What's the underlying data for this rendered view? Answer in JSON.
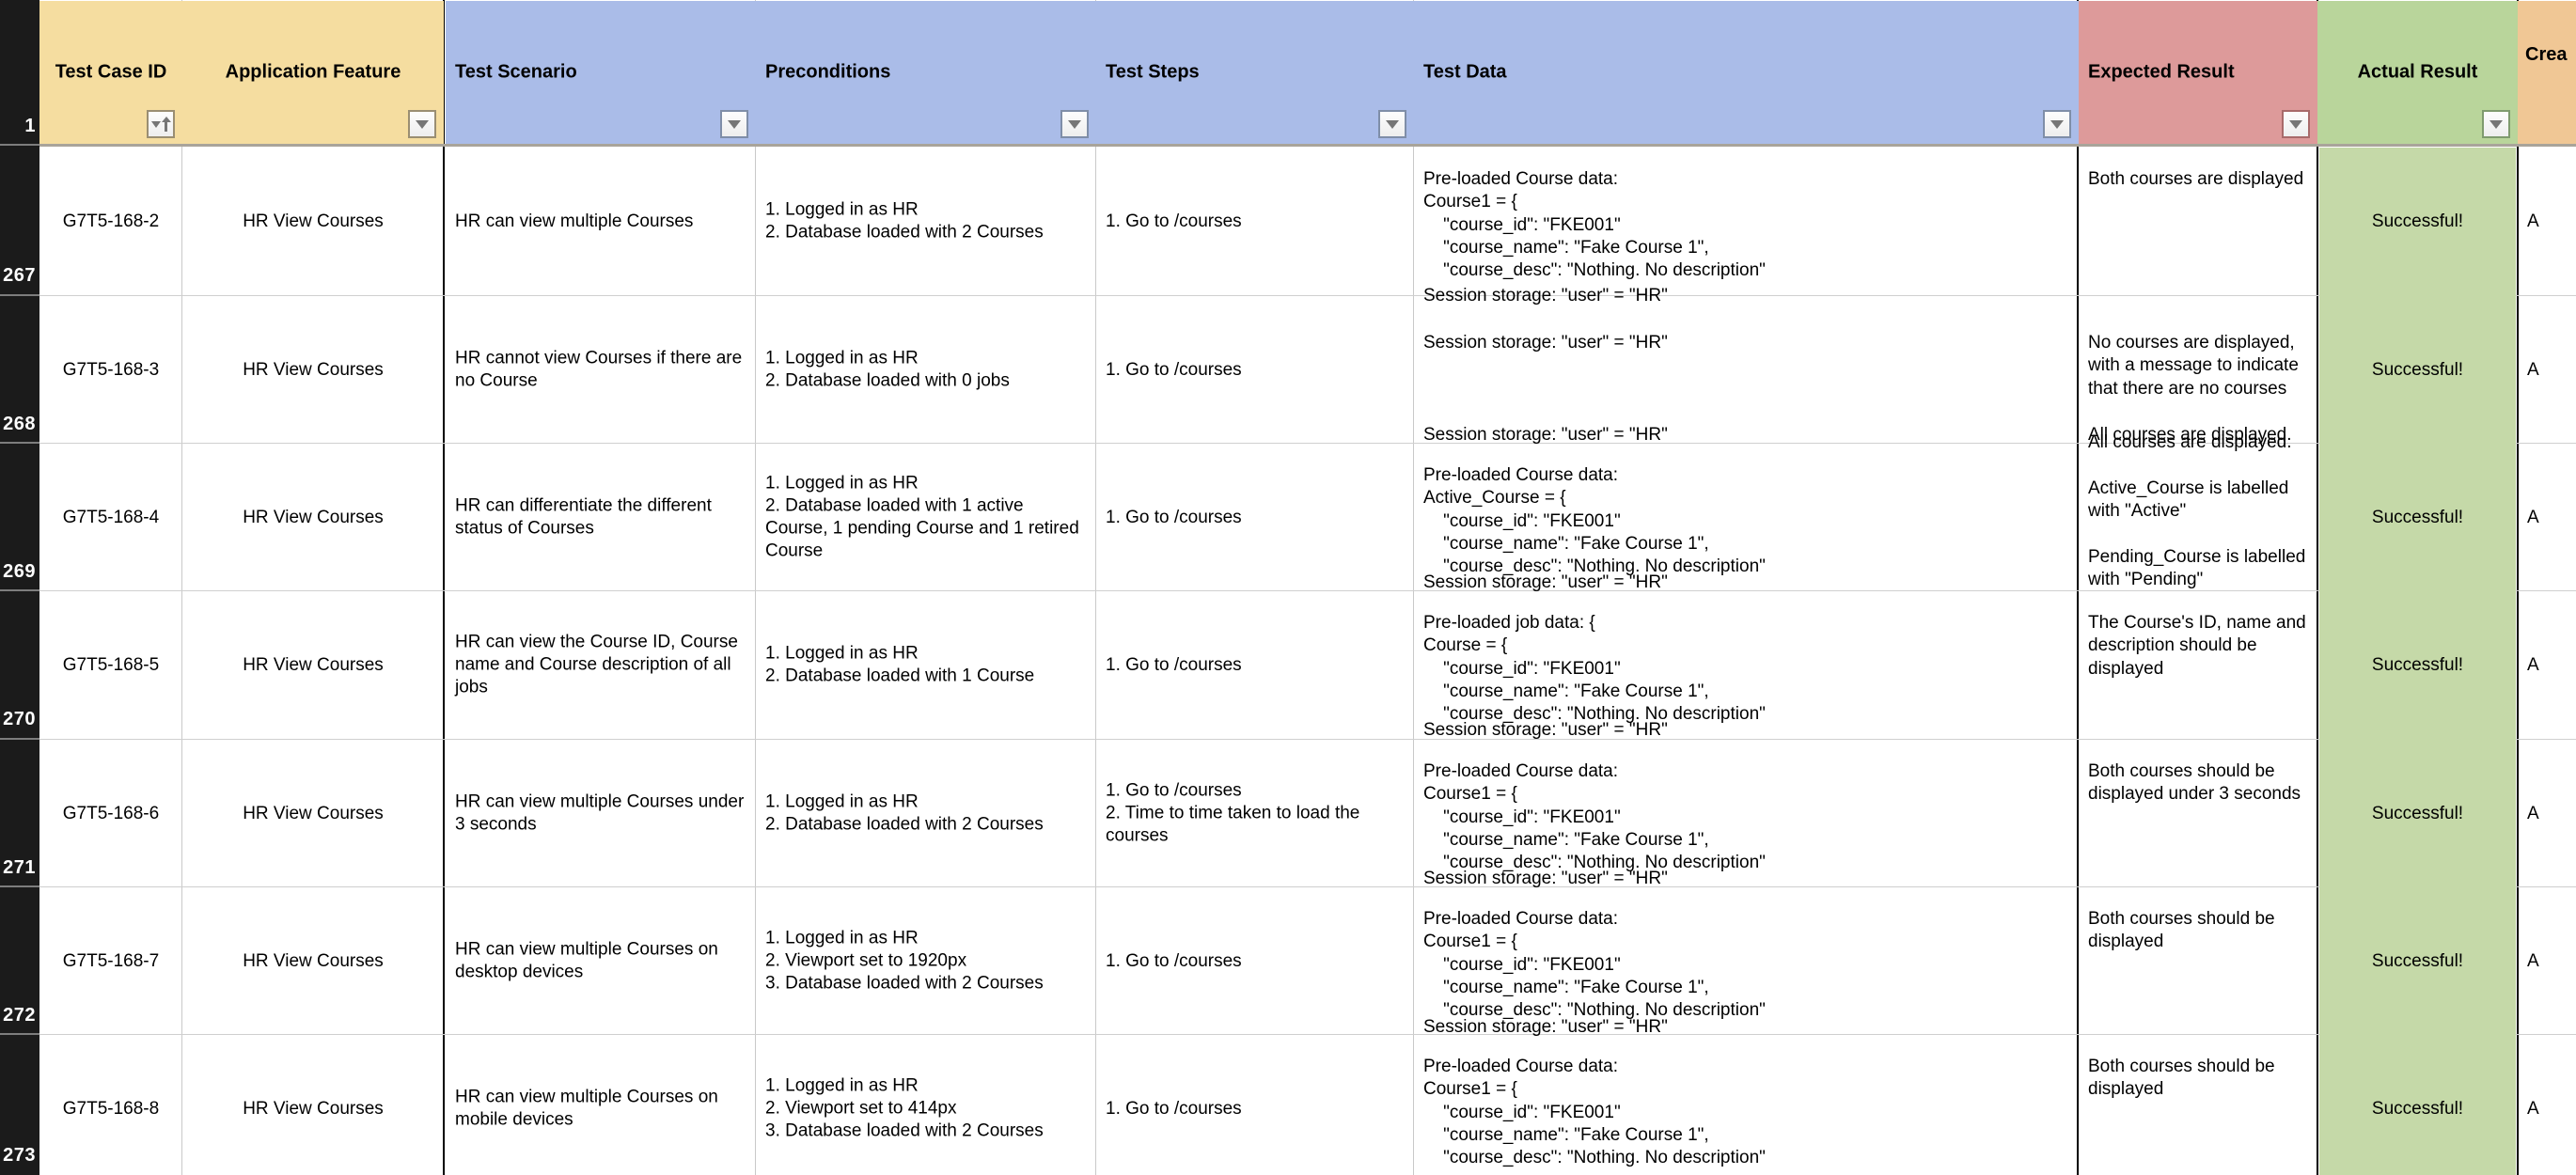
{
  "spreadsheet": {
    "frozen_header_row_number": "1",
    "columns": [
      {
        "key": "test_case_id",
        "label": "Test Case ID",
        "header_color": "#f5dda0",
        "filter": "sort-asc-filter-icon"
      },
      {
        "key": "application_feature",
        "label": "Application Feature",
        "header_color": "#f5dda0",
        "filter": "filter-dropdown-icon"
      },
      {
        "key": "test_scenario",
        "label": "Test Scenario",
        "header_color": "#aabce8",
        "filter": "filter-dropdown-icon"
      },
      {
        "key": "preconditions",
        "label": "Preconditions",
        "header_color": "#aabce8",
        "filter": "filter-dropdown-icon"
      },
      {
        "key": "test_steps",
        "label": "Test Steps",
        "header_color": "#aabce8",
        "filter": "filter-dropdown-icon"
      },
      {
        "key": "test_data",
        "label": "Test Data",
        "header_color": "#aabce8",
        "filter": "filter-dropdown-icon"
      },
      {
        "key": "expected_result",
        "label": "Expected Result",
        "header_color": "#dd9a9a",
        "filter": "filter-dropdown-icon"
      },
      {
        "key": "actual_result",
        "label": "Actual Result",
        "header_color": "#b9d59b",
        "filter": "filter-dropdown-icon"
      },
      {
        "key": "created_by",
        "label": "Crea",
        "header_color": "#f0c795",
        "filter": "none"
      }
    ],
    "rows": [
      {
        "row_number": "267",
        "test_case_id": "G7T5-168-2",
        "application_feature": "HR View Courses",
        "test_scenario": "HR can view multiple Courses",
        "preconditions": "1. Logged in as HR\n2. Database loaded with 2 Courses",
        "test_steps": "1. Go to /courses",
        "test_data": "Pre-loaded Course data:\nCourse1 = {\n    \"course_id\": \"FKE001\"\n    \"course_name\": \"Fake Course 1\",\n    \"course_desc\": \"Nothing. No description\"",
        "test_data_tail": "Session storage: \"user\" = \"HR\"",
        "expected_result": "Both courses are displayed",
        "actual_result": "Successful!",
        "created_by": "A"
      },
      {
        "row_number": "268",
        "test_case_id": "G7T5-168-3",
        "application_feature": "HR View Courses",
        "test_scenario": "HR cannot view Courses if there are no Course",
        "preconditions": "1. Logged in as HR\n2. Database loaded with 0 jobs",
        "test_steps": "1. Go to /courses",
        "test_data": "Session storage: \"user\" = \"HR\"",
        "test_data_tail": "Session storage: \"user\" = \"HR\"",
        "expected_result": "No courses are displayed, with a message to indicate that there are no courses",
        "expected_result_tail": "All courses are displayed.",
        "actual_result": "Successful!",
        "created_by": "A"
      },
      {
        "row_number": "269",
        "test_case_id": "G7T5-168-4",
        "application_feature": "HR View Courses",
        "test_scenario": "HR can differentiate the different status of Courses",
        "preconditions": "1. Logged in as HR\n2. Database loaded with 1 active Course, 1 pending Course and 1 retired Course",
        "test_steps": "1. Go to /courses",
        "test_data": "Pre-loaded Course data:\nActive_Course = {\n    \"course_id\": \"FKE001\"\n    \"course_name\": \"Fake Course 1\",\n    \"course_desc\": \"Nothing. No description\"",
        "test_data_tail": "Session storage: \"user\" = \"HR\"",
        "expected_result": "All courses are displayed.\n\nActive_Course is labelled with \"Active\"\n\nPending_Course is labelled with \"Pending\"",
        "actual_result": "Successful!",
        "created_by": "A"
      },
      {
        "row_number": "270",
        "test_case_id": "G7T5-168-5",
        "application_feature": "HR View Courses",
        "test_scenario": "HR can view the Course ID, Course name and Course description of all jobs",
        "preconditions": "1. Logged in as HR\n2. Database loaded with 1 Course",
        "test_steps": "1. Go to /courses",
        "test_data": "Pre-loaded job data: {\nCourse = {\n    \"course_id\": \"FKE001\"\n    \"course_name\": \"Fake Course 1\",\n    \"course_desc\": \"Nothing. No description\"",
        "test_data_tail": "Session storage: \"user\" = \"HR\"",
        "expected_result": "The Course's ID, name and description should be displayed",
        "actual_result": "Successful!",
        "created_by": "A"
      },
      {
        "row_number": "271",
        "test_case_id": "G7T5-168-6",
        "application_feature": "HR View Courses",
        "test_scenario": "HR can view multiple Courses under 3 seconds",
        "preconditions": "1. Logged in as HR\n2. Database loaded with 2 Courses",
        "test_steps": "1. Go to /courses\n2. Time to time taken to load the courses",
        "test_data": "Pre-loaded Course data:\nCourse1 = {\n    \"course_id\": \"FKE001\"\n    \"course_name\": \"Fake Course 1\",\n    \"course_desc\": \"Nothing. No description\"",
        "test_data_tail": "Session storage: \"user\" = \"HR\"",
        "expected_result": "Both courses should be displayed under 3 seconds",
        "actual_result": "Successful!",
        "created_by": "A"
      },
      {
        "row_number": "272",
        "test_case_id": "G7T5-168-7",
        "application_feature": "HR View Courses",
        "test_scenario": "HR can view multiple Courses on desktop devices",
        "preconditions": "1. Logged in as HR\n2. Viewport set to 1920px\n3. Database loaded with 2 Courses",
        "test_steps": "1. Go to /courses",
        "test_data": "Pre-loaded Course data:\nCourse1 = {\n    \"course_id\": \"FKE001\"\n    \"course_name\": \"Fake Course 1\",\n    \"course_desc\": \"Nothing. No description\"",
        "test_data_tail": "Session storage: \"user\" = \"HR\"",
        "expected_result": "Both courses should be displayed",
        "actual_result": "Successful!",
        "created_by": "A"
      },
      {
        "row_number": "273",
        "test_case_id": "G7T5-168-8",
        "application_feature": "HR View Courses",
        "test_scenario": "HR can view multiple Courses on mobile devices",
        "preconditions": "1. Logged in as HR\n2. Viewport set to 414px\n3. Database loaded with 2 Courses",
        "test_steps": "1. Go to /courses",
        "test_data": "Pre-loaded Course data:\nCourse1 = {\n    \"course_id\": \"FKE001\"\n    \"course_name\": \"Fake Course 1\",\n    \"course_desc\": \"Nothing. No description\"",
        "test_data_tail": "",
        "expected_result": "Both courses should be displayed",
        "actual_result": "Successful!",
        "created_by": "A"
      }
    ]
  }
}
